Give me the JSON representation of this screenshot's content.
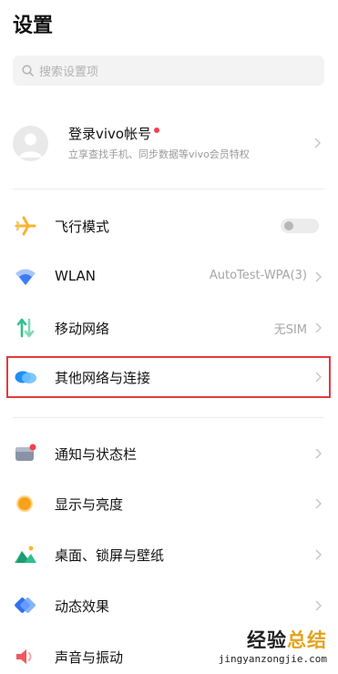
{
  "header": {
    "title": "设置"
  },
  "search": {
    "placeholder": "搜索设置项",
    "icon": "search-icon"
  },
  "account": {
    "title": "登录vivo帐号",
    "subtitle": "立享查找手机、同步数据等vivo会员特权",
    "badge_color": "#f5404e"
  },
  "rows": [
    {
      "label": "飞行模式",
      "icon": "airplane-icon",
      "toggle": false
    },
    {
      "label": "WLAN",
      "value": "AutoTest-WPA(3)",
      "icon": "wifi-icon"
    },
    {
      "label": "移动网络",
      "value": "无SIM",
      "icon": "mobile-network-icon"
    },
    {
      "label": "其他网络与连接",
      "icon": "cloud-connection-icon",
      "highlighted": true
    },
    {
      "label": "通知与状态栏",
      "icon": "notification-icon"
    },
    {
      "label": "显示与亮度",
      "icon": "brightness-icon"
    },
    {
      "label": "桌面、锁屏与壁纸",
      "icon": "wallpaper-icon"
    },
    {
      "label": "动态效果",
      "icon": "animation-icon"
    },
    {
      "label": "声音与振动",
      "icon": "sound-icon"
    }
  ],
  "watermark": {
    "part1": "经验",
    "part2": "总结",
    "url": "jingyanzongjie.com"
  },
  "colors": {
    "highlight_border": "#e23b3b",
    "airplane": "#f6b433",
    "wifi": "#3d7cf2"
  }
}
